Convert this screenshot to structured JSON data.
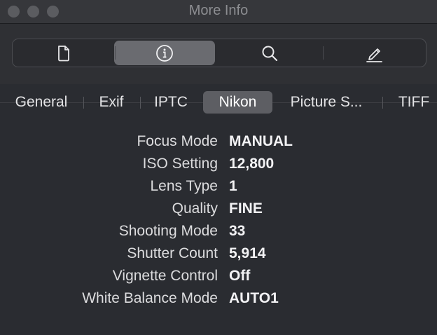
{
  "window": {
    "title": "More Info"
  },
  "toolbar": {
    "segments": [
      {
        "icon": "document-icon",
        "selected": false
      },
      {
        "icon": "info-icon",
        "selected": true
      },
      {
        "icon": "search-icon",
        "selected": false
      },
      {
        "icon": "pencil-icon",
        "selected": false
      }
    ]
  },
  "tabs": [
    {
      "label": "General",
      "selected": false
    },
    {
      "label": "Exif",
      "selected": false
    },
    {
      "label": "IPTC",
      "selected": false
    },
    {
      "label": "Nikon",
      "selected": true
    },
    {
      "label": "Picture S...",
      "selected": false
    },
    {
      "label": "TIFF",
      "selected": false
    }
  ],
  "properties": [
    {
      "label": "Focus Mode",
      "value": "MANUAL"
    },
    {
      "label": "ISO Setting",
      "value": "12,800"
    },
    {
      "label": "Lens Type",
      "value": "1"
    },
    {
      "label": "Quality",
      "value": "FINE"
    },
    {
      "label": "Shooting Mode",
      "value": "33"
    },
    {
      "label": "Shutter Count",
      "value": "5,914"
    },
    {
      "label": "Vignette Control",
      "value": "Off"
    },
    {
      "label": "White Balance Mode",
      "value": "AUTO1"
    }
  ],
  "colors": {
    "background": "#2a2c31",
    "titlebar": "#36373b",
    "selected_segment": "#6a6b70",
    "selected_tab": "#5d5e63"
  }
}
